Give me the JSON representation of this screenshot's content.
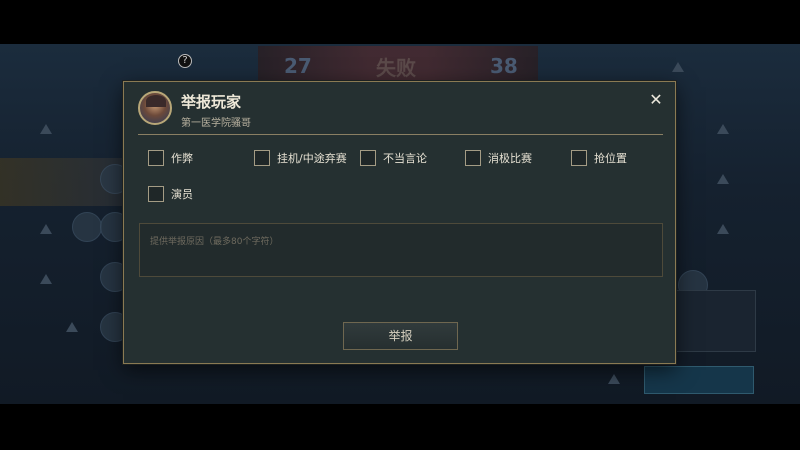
{
  "background": {
    "score_left": "27",
    "score_mid": "失败",
    "score_right": "38",
    "help_icon": "?"
  },
  "dialog": {
    "title": "举报玩家",
    "player_name": "第一医学院骚哥",
    "close_icon": "✕",
    "options": [
      {
        "label": "作弊",
        "checked": false
      },
      {
        "label": "挂机/中途弃赛",
        "checked": false
      },
      {
        "label": "不当言论",
        "checked": false
      },
      {
        "label": "消极比赛",
        "checked": false
      },
      {
        "label": "抢位置",
        "checked": false
      },
      {
        "label": "演员",
        "checked": false
      }
    ],
    "reason_placeholder": "提供举报原因（最多80个字符）",
    "submit_label": "举报"
  }
}
